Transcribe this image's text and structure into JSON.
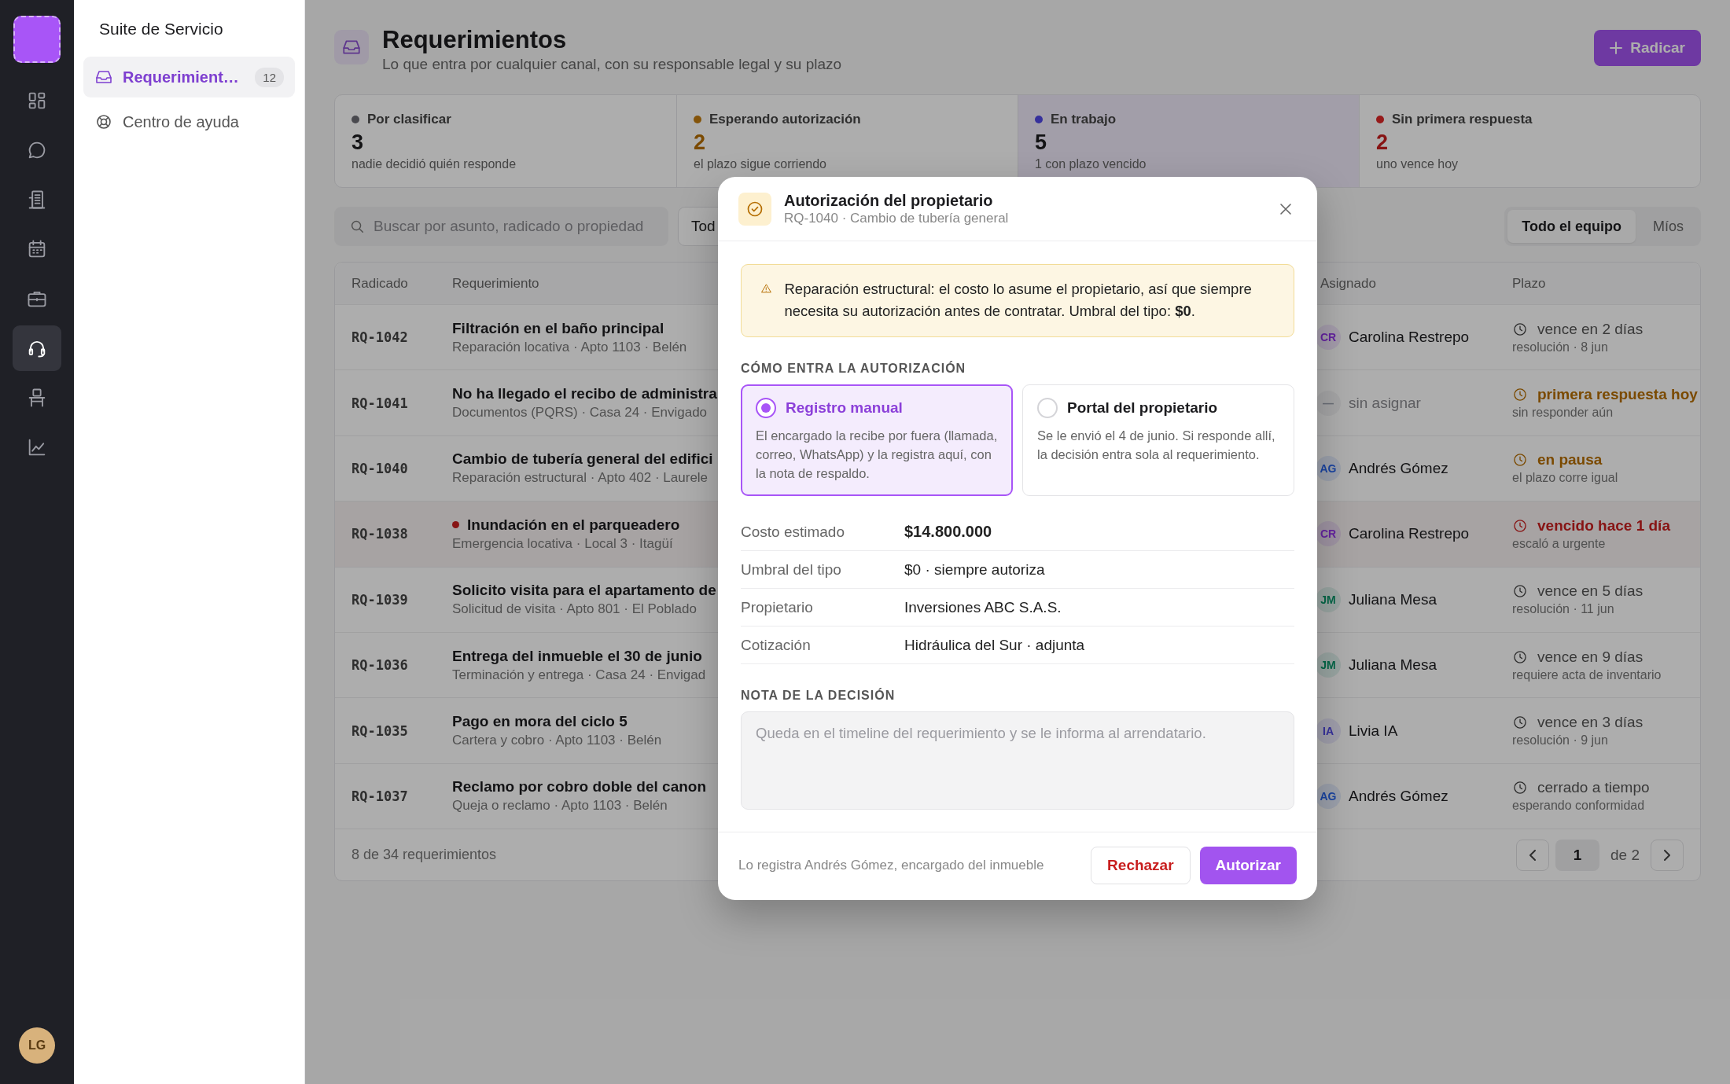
{
  "rail": {
    "items": [
      {
        "selected": false
      },
      {
        "selected": false
      },
      {
        "selected": false
      },
      {
        "selected": false
      },
      {
        "selected": false
      },
      {
        "selected": true
      },
      {
        "selected": false
      },
      {
        "selected": false
      }
    ],
    "user": "LG"
  },
  "sidebar": {
    "title": "Suite de Servicio",
    "items": [
      {
        "label": "Requerimient…",
        "badge": "12",
        "selected": true
      },
      {
        "label": "Centro de ayuda",
        "selected": false
      }
    ]
  },
  "header": {
    "title": "Requerimientos",
    "subtitle": "Lo que entra por cualquier canal, con su responsable legal y su plazo",
    "action": "Radicar"
  },
  "stats": [
    {
      "label": "Por clasificar",
      "value": "3",
      "note": "nadie decidió quién responde",
      "color": "#49494e",
      "kind": "neutral",
      "selected": false
    },
    {
      "label": "Esperando autorización",
      "value": "2",
      "note": "el plazo sigue corriendo",
      "color": "#84540a",
      "kind": "warning",
      "selected": false
    },
    {
      "label": "En trabajo",
      "value": "5",
      "note": "1 con plazo vencido",
      "color": "#36309c",
      "kind": "neutral",
      "selected": true
    },
    {
      "label": "Sin primera respuesta",
      "value": "2",
      "note": "uno vence hoy",
      "color": "#961a1a",
      "kind": "danger",
      "selected": false
    }
  ],
  "filters": {
    "search": {
      "placeholder": "Buscar por asunto, radicado o propiedad"
    },
    "dropdown": "Tod",
    "scope": [
      {
        "label": "Todo el equipo",
        "selected": true
      },
      {
        "label": "Míos",
        "selected": false
      }
    ]
  },
  "table": {
    "columns": [
      "Radicado",
      "Requerimiento",
      "Asignado",
      "Plazo"
    ],
    "rows": [
      {
        "id": "RQ-1042",
        "title": "Filtración en el baño principal",
        "subtitle": "Reparación locativa · Apto 1103 · Belén",
        "urgent": false,
        "assignee": {
          "initials": "CR",
          "name": "Carolina Restrepo",
          "color": "#64239f",
          "assigned": true
        },
        "deadline": {
          "text": "vence en 2 días",
          "note": "resolución · 8 jun",
          "kind": "normal"
        }
      },
      {
        "id": "RQ-1041",
        "title": "No ha llegado el recibo de administra",
        "subtitle": "Documentos (PQRS) · Casa 24 · Envigado",
        "urgent": false,
        "assignee": {
          "initials": "—",
          "name": "sin asignar",
          "color": "#6a6e77",
          "assigned": false
        },
        "deadline": {
          "text": "primera respuesta hoy",
          "note": "sin responder aún",
          "kind": "warning"
        }
      },
      {
        "id": "RQ-1040",
        "title": "Cambio de tubería general del edifici",
        "subtitle": "Reparación estructural · Apto 402 · Laurele",
        "urgent": false,
        "assignee": {
          "initials": "AG",
          "name": "Andrés Gómez",
          "color": "#1943a0",
          "assigned": true
        },
        "deadline": {
          "text": "en pausa",
          "note": "el plazo corre igual",
          "kind": "warning"
        }
      },
      {
        "id": "RQ-1038",
        "title": "Inundación en el parqueadero",
        "subtitle": "Emergencia locativa · Local 3 · Itagüí",
        "urgent": true,
        "assignee": {
          "initials": "CR",
          "name": "Carolina Restrepo",
          "color": "#64239f",
          "assigned": true
        },
        "deadline": {
          "text": "vencido hace 1 día",
          "note": "escaló a urgente",
          "kind": "danger"
        }
      },
      {
        "id": "RQ-1039",
        "title": "Solicito visita para el apartamento de",
        "subtitle": "Solicitud de visita · Apto 801 · El Poblado",
        "urgent": false,
        "assignee": {
          "initials": "JM",
          "name": "Juliana Mesa",
          "color": "#036647",
          "assigned": true
        },
        "deadline": {
          "text": "vence en 5 días",
          "note": "resolución · 11 jun",
          "kind": "normal"
        }
      },
      {
        "id": "RQ-1036",
        "title": "Entrega del inmueble el 30 de junio",
        "subtitle": "Terminación y entrega · Casa 24 · Envigad",
        "urgent": false,
        "assignee": {
          "initials": "JM",
          "name": "Juliana Mesa",
          "color": "#036647",
          "assigned": true
        },
        "deadline": {
          "text": "vence en 9 días",
          "note": "requiere acta de inventario",
          "kind": "normal"
        }
      },
      {
        "id": "RQ-1035",
        "title": "Pago en mora del ciclo 5",
        "subtitle": "Cartera y cobro · Apto 1103 · Belén",
        "urgent": false,
        "assignee": {
          "initials": "IA",
          "name": "Livia IA",
          "color": "#36309c",
          "assigned": true
        },
        "deadline": {
          "text": "vence en 3 días",
          "note": "resolución · 9 jun",
          "kind": "normal"
        }
      },
      {
        "id": "RQ-1037",
        "title": "Reclamo por cobro doble del canon",
        "subtitle": "Queja o reclamo · Apto 1103 · Belén",
        "urgent": false,
        "assignee": {
          "initials": "AG",
          "name": "Andrés Gómez",
          "color": "#1943a0",
          "assigned": true
        },
        "deadline": {
          "text": "cerrado a tiempo",
          "note": "esperando conformidad",
          "kind": "normal"
        }
      }
    ],
    "footer": "8 de 34 requerimientos",
    "pagination": {
      "page": "1",
      "total": "de 2"
    }
  },
  "modal": {
    "title": "Autorización del propietario",
    "subtitle": "RQ-1040 · Cambio de tubería general",
    "warning": "Reparación estructural: el costo lo asume el propietario, así que siempre necesita su autorización antes de contratar. Umbral del tipo: **$0**.",
    "options_label": "CÓMO ENTRA LA AUTORIZACIÓN",
    "options": [
      {
        "title": "Registro manual",
        "description": "El encargado la recibe por fuera (llamada, correo, WhatsApp) y la registra aquí, con la nota de respaldo.",
        "selected": true
      },
      {
        "title": "Portal del propietario",
        "description": "Se le envió el 4 de junio. Si responde allí, la decisión entra sola al requerimiento.",
        "selected": false
      }
    ],
    "details": [
      {
        "label": "Costo estimado",
        "value": "$14.800.000",
        "emphasis": true
      },
      {
        "label": "Umbral del tipo",
        "value": "$0 · siempre autoriza",
        "emphasis": false
      },
      {
        "label": "Propietario",
        "value": "Inversiones ABC S.A.S.",
        "emphasis": false
      },
      {
        "label": "Cotización",
        "value": "Hidráulica del Sur · adjunta",
        "emphasis": false
      }
    ],
    "note_label": "NOTA DE LA DECISIÓN",
    "note": {
      "placeholder": "Queda en el timeline del requerimiento y se le informa al arrendatario."
    },
    "footer": "Lo registra Andrés Gómez, encargado del inmueble",
    "reject": "Rechazar",
    "approve": "Autorizar"
  }
}
